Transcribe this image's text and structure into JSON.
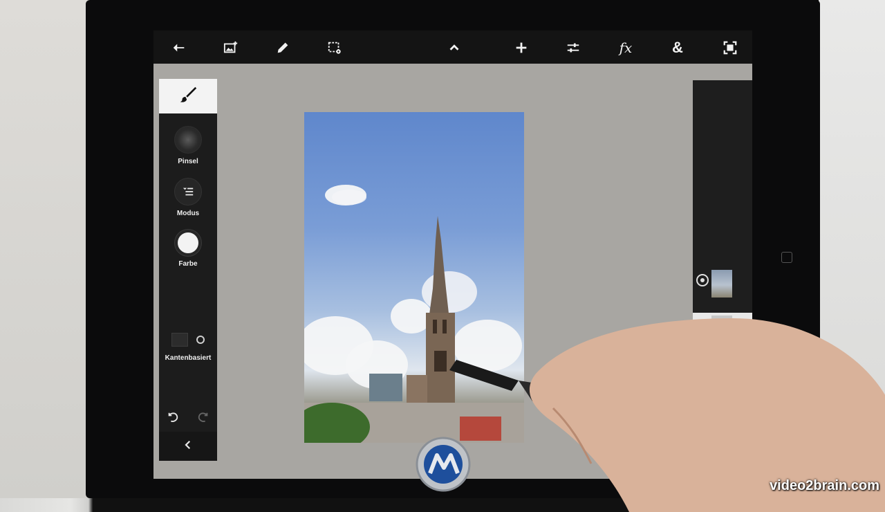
{
  "toolbar": {
    "items": [
      {
        "icon": "back-arrow-icon"
      },
      {
        "icon": "add-image-icon"
      },
      {
        "icon": "pencil-icon"
      },
      {
        "icon": "selection-settings-icon"
      },
      {
        "icon": "chevron-up-icon"
      },
      {
        "icon": "plus-icon"
      },
      {
        "icon": "adjustments-icon",
        "label": ""
      },
      {
        "icon": "fx-icon",
        "label": "fx"
      },
      {
        "icon": "ampersand-icon",
        "label": "&"
      },
      {
        "icon": "fullscreen-icon"
      }
    ]
  },
  "tool_panel": {
    "active_tool_icon": "brush-icon",
    "brush_label": "Pinsel",
    "mode_label": "Modus",
    "color_label": "Farbe",
    "color_value": "#f3f3f3",
    "edge_toggle_label": "Kantenbasiert",
    "undo_icon": "undo-icon",
    "redo_icon": "redo-icon",
    "collapse_icon": "chevron-left-icon"
  },
  "layers": {
    "items": [
      {
        "name": "layer-1",
        "selected": true
      },
      {
        "name": "layer-2",
        "selected": false
      }
    ]
  },
  "watermark": {
    "text": "video2brain.com"
  },
  "colors": {
    "toolbar_bg": "#141414",
    "canvas_bg": "#a8a6a2",
    "panel_bg": "#1c1c1c"
  }
}
